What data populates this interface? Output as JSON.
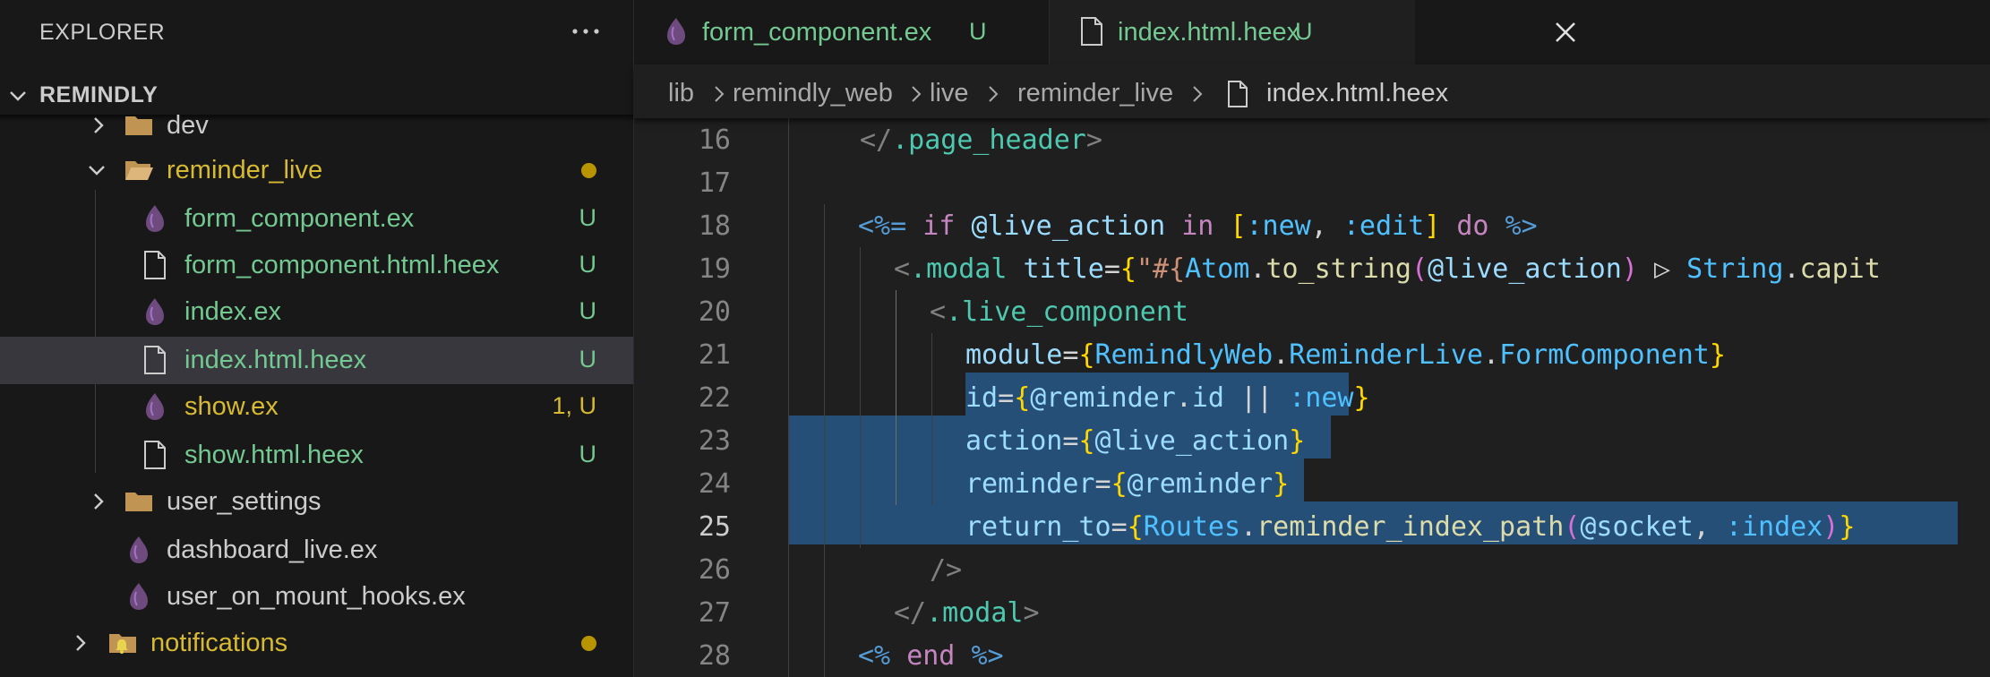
{
  "sidebar": {
    "title": "EXPLORER",
    "section_title": "REMINDLY",
    "items": [
      {
        "label": "dev",
        "badge": "",
        "icon": "folder-icon"
      },
      {
        "label": "reminder_live",
        "badge": "",
        "icon": "folder-open-icon",
        "modified_dot": true
      },
      {
        "label": "form_component.ex",
        "badge": "U",
        "icon": "elixir-icon"
      },
      {
        "label": "form_component.html.heex",
        "badge": "U",
        "icon": "file-icon"
      },
      {
        "label": "index.ex",
        "badge": "U",
        "icon": "elixir-icon"
      },
      {
        "label": "index.html.heex",
        "badge": "U",
        "icon": "file-icon",
        "selected": true
      },
      {
        "label": "show.ex",
        "badge": "1, U",
        "icon": "elixir-icon"
      },
      {
        "label": "show.html.heex",
        "badge": "U",
        "icon": "file-icon"
      },
      {
        "label": "user_settings",
        "badge": "",
        "icon": "folder-icon"
      },
      {
        "label": "dashboard_live.ex",
        "badge": "",
        "icon": "elixir-icon"
      },
      {
        "label": "user_on_mount_hooks.ex",
        "badge": "",
        "icon": "elixir-icon"
      },
      {
        "label": "notifications",
        "badge": "",
        "icon": "notifications-folder-icon",
        "modified_dot": true
      }
    ]
  },
  "tabs": [
    {
      "label": "form_component.ex",
      "badge": "U",
      "icon": "elixir-icon",
      "active": false
    },
    {
      "label": "index.html.heex",
      "badge": "U",
      "icon": "file-icon",
      "active": true
    }
  ],
  "breadcrumb": [
    "lib",
    "remindly_web",
    "live",
    "reminder_live",
    "index.html.heex"
  ],
  "editor": {
    "active_line": 25,
    "lines": [
      {
        "n": "16"
      },
      {
        "n": "17"
      },
      {
        "n": "18"
      },
      {
        "n": "19"
      },
      {
        "n": "20"
      },
      {
        "n": "21"
      },
      {
        "n": "22"
      },
      {
        "n": "23"
      },
      {
        "n": "24"
      },
      {
        "n": "25"
      },
      {
        "n": "26"
      },
      {
        "n": "27"
      },
      {
        "n": "28"
      }
    ]
  },
  "colors": {
    "untracked": "#73c991",
    "modified": "#d7ba32",
    "selection": "#264f78",
    "elixir": "#6e4a7e"
  }
}
